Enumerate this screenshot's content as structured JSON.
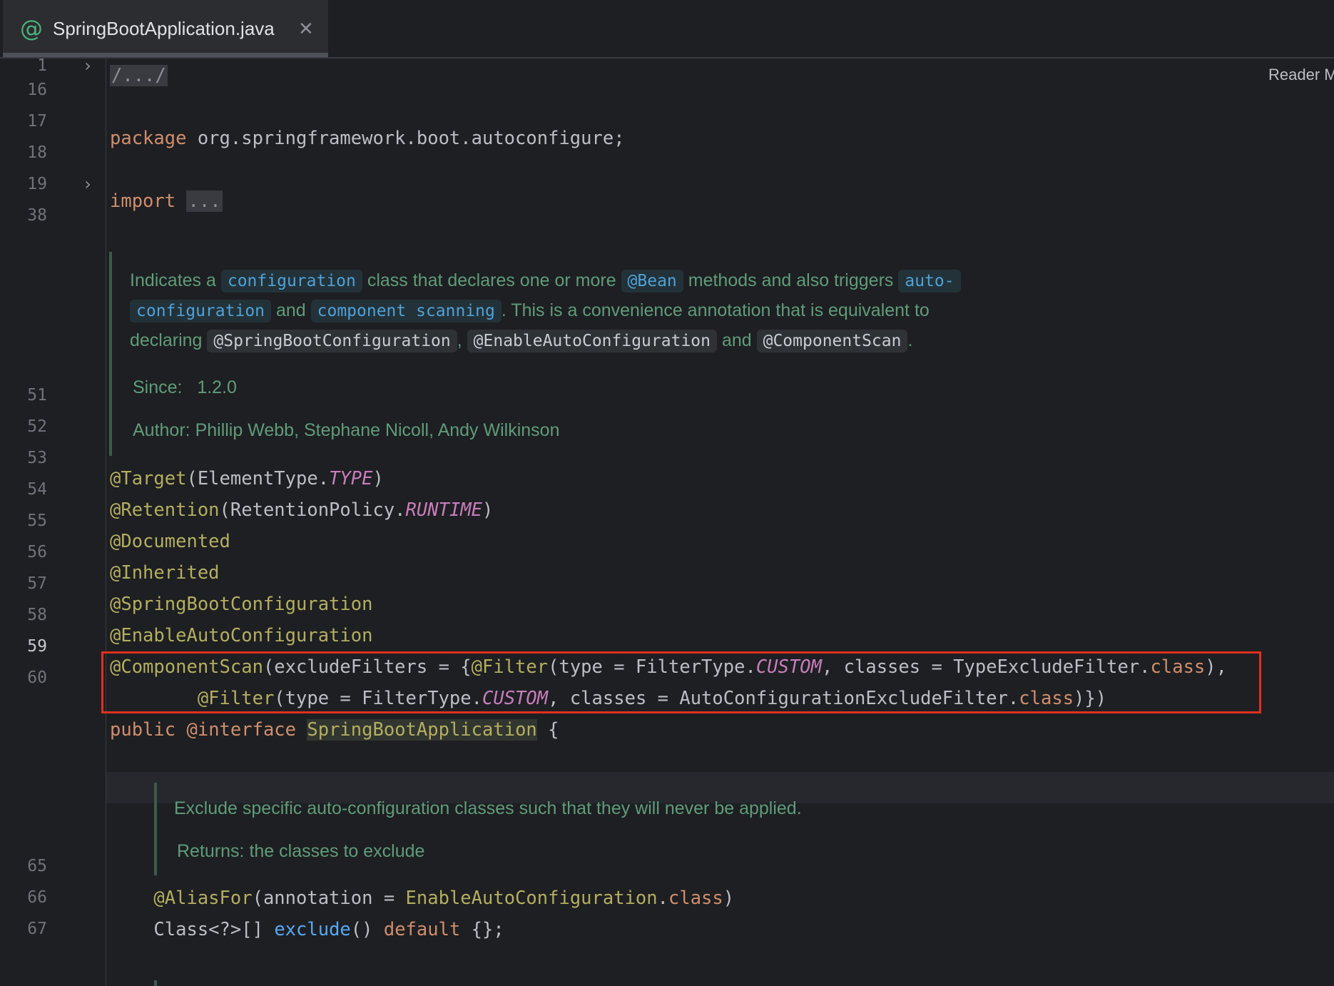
{
  "tab": {
    "label": "SpringBootApplication.java",
    "icon": "annotation-icon",
    "close": "✕"
  },
  "toolbar": {
    "reader_mode": "Reader M"
  },
  "line_numbers": [
    "1",
    "16",
    "17",
    "18",
    "19",
    "38",
    "51",
    "52",
    "53",
    "54",
    "55",
    "56",
    "57",
    "58",
    "59",
    "60",
    "65",
    "66",
    "67"
  ],
  "code": {
    "l1": "/.../",
    "l17_kw": "package",
    "l17_rest": " org.springframework.boot.autoconfigure;",
    "l19_kw": "import",
    "l19_fold": "...",
    "l51_ann": "@Target",
    "l51_a": "(ElementType.",
    "l51_c": "TYPE",
    "l51_b": ")",
    "l52_ann": "@Retention",
    "l52_a": "(RetentionPolicy.",
    "l52_c": "RUNTIME",
    "l52_b": ")",
    "l53": "@Documented",
    "l54": "@Inherited",
    "l55": "@SpringBootConfiguration",
    "l56": "@EnableAutoConfiguration",
    "l57_ann": "@ComponentScan",
    "l57_a": "(excludeFilters = {",
    "l57_ann2": "@Filter",
    "l57_b": "(type = FilterType.",
    "l57_c": "CUSTOM",
    "l57_d": ", classes = TypeExcludeFilter.",
    "l57_kw": "class",
    "l57_e": "),",
    "l58_indent": "        ",
    "l58_ann": "@Filter",
    "l58_a": "(type = FilterType.",
    "l58_c": "CUSTOM",
    "l58_b": ", classes = AutoConfigurationExcludeFilter.",
    "l58_kw": "class",
    "l58_e": ")})",
    "l59_kw": "public",
    "l59_kw2": "@interface",
    "l59_name": "SpringBootApplication",
    "l59_brace": " {",
    "l65_indent": "    ",
    "l65_ann": "@AliasFor",
    "l65_a": "(annotation = ",
    "l65_cls": "EnableAutoConfiguration",
    "l65_b": ".",
    "l65_kw": "class",
    "l65_e": ")",
    "l66_indent": "    ",
    "l66_a": "Class<?>[] ",
    "l66_fn": "exclude",
    "l66_b": "() ",
    "l66_kw": "default",
    "l66_e": " {};"
  },
  "doc1": {
    "t1": "Indicates a ",
    "c1": "configuration",
    "t2": " class that declares one or more ",
    "c2": "@Bean",
    "t3": " methods and also triggers ",
    "c3": "auto-",
    "c4": "configuration",
    "t4": " and ",
    "c5": "component scanning",
    "t5": ". This is a convenience annotation that is equivalent to",
    "t6": "declaring ",
    "c6": "@SpringBootConfiguration",
    "t7": ", ",
    "c7": "@EnableAutoConfiguration",
    "t8": " and ",
    "c8": "@ComponentScan",
    "t9": ".",
    "since_label": "Since:",
    "since_value": "1.2.0",
    "author_label": "Author:",
    "author_value": "Phillip Webb, Stephane Nicoll, Andy Wilkinson"
  },
  "doc2": {
    "text": "Exclude specific auto-configuration classes such that they will never be applied.",
    "returns_label": "Returns:",
    "returns_value": "the classes to exclude"
  },
  "colors": {
    "highlight_box": "#e0301e",
    "background": "#1e1f22"
  }
}
